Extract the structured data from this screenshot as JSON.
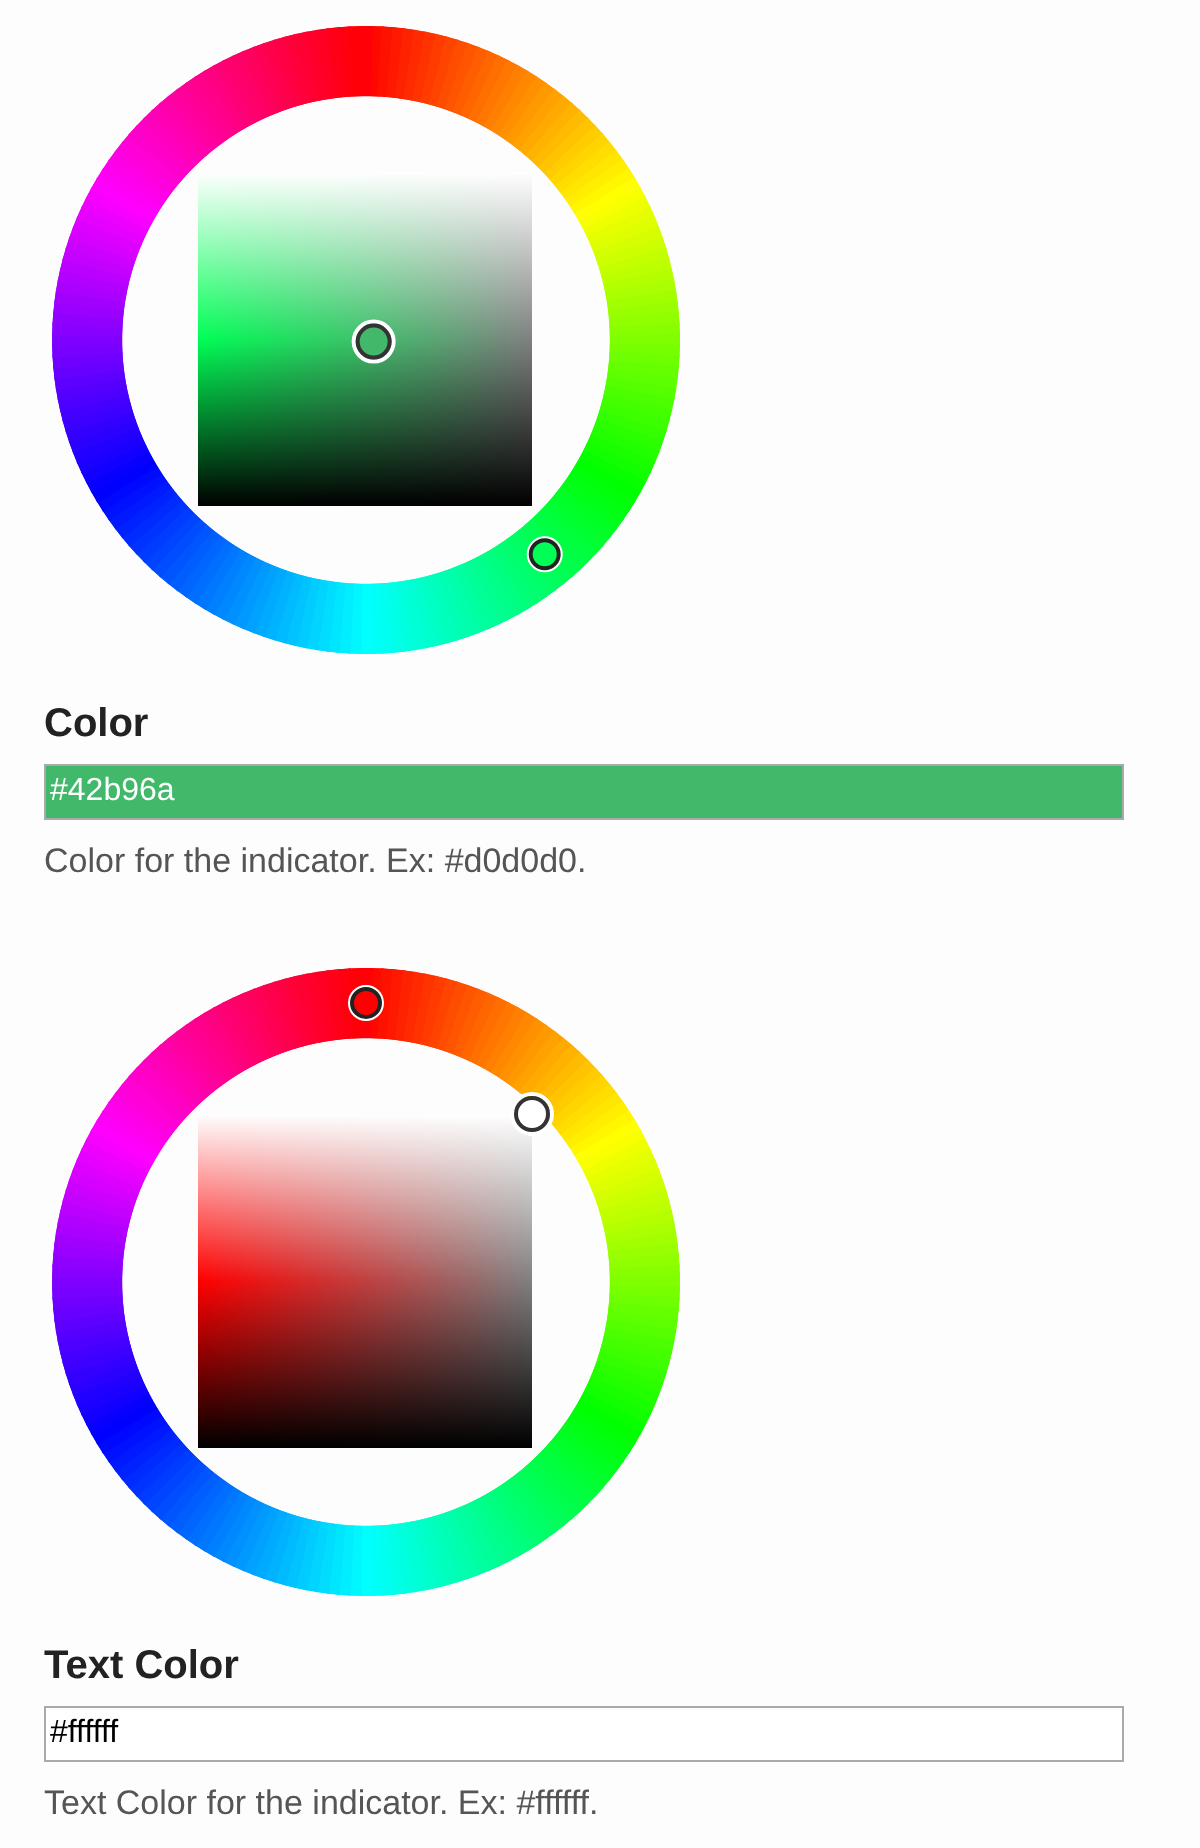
{
  "pickers": [
    {
      "label": "Color",
      "value": "#42b96a",
      "description": "Color for the indicator. Ex: #d0d0d0."
    },
    {
      "label": "Text Color",
      "value": "#ffffff",
      "description": "Text Color for the indicator. Ex: #ffffff."
    }
  ]
}
